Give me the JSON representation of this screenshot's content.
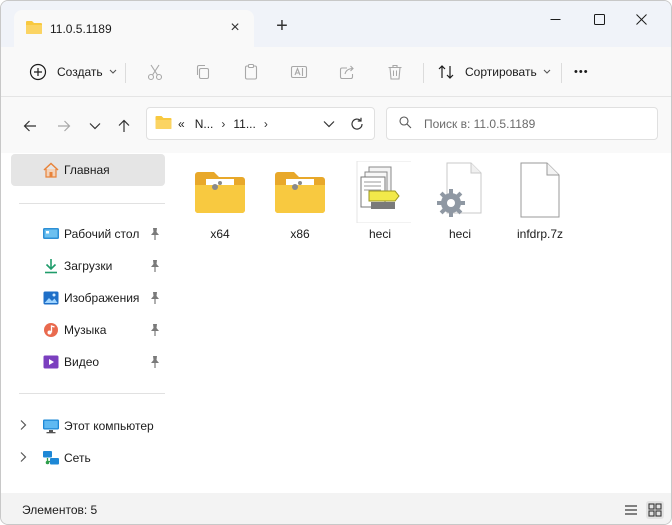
{
  "window": {
    "tab_title": "11.0.5.1189",
    "tab_close": "×",
    "new_tab": "+"
  },
  "toolbar": {
    "create_label": "Создать",
    "sort_label": "Сортировать",
    "more_label": "•••"
  },
  "address": {
    "chevrons": "«",
    "crumbs": [
      "N...",
      "11..."
    ],
    "search_placeholder": "Поиск в: 11.0.5.1189"
  },
  "sidebar": {
    "home": "Главная",
    "quick_access": [
      {
        "label": "Рабочий стол",
        "icon": "desktop-icon"
      },
      {
        "label": "Загрузки",
        "icon": "downloads-icon"
      },
      {
        "label": "Изображения",
        "icon": "pictures-icon"
      },
      {
        "label": "Музыка",
        "icon": "music-icon"
      },
      {
        "label": "Видео",
        "icon": "videos-icon"
      }
    ],
    "this_pc": "Этот компьютер",
    "network": "Сеть"
  },
  "files": [
    {
      "name": "x64",
      "type": "folder"
    },
    {
      "name": "x86",
      "type": "folder"
    },
    {
      "name": "heci",
      "type": "catalog"
    },
    {
      "name": "heci",
      "type": "settings-file"
    },
    {
      "name": "infdrp.7z",
      "type": "blank-file"
    }
  ],
  "status": {
    "items_count": "Элементов: 5"
  },
  "colors": {
    "folder_yellow": "#f8c940",
    "accent_blue": "#0067c0",
    "selected_bg": "#e5e5e5"
  }
}
